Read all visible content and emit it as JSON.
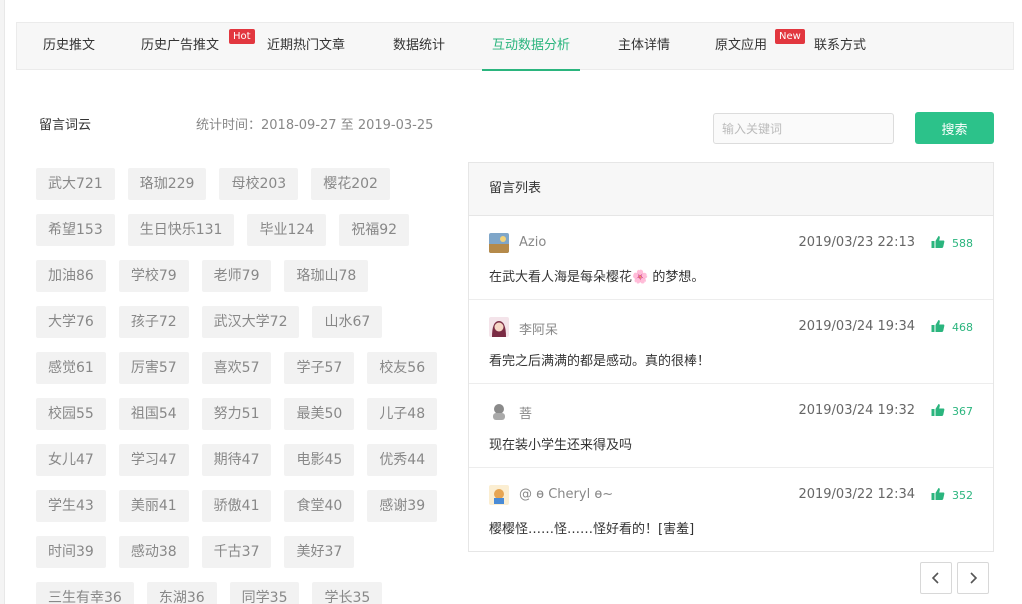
{
  "tabs": [
    {
      "label": "历史推文",
      "badge": ""
    },
    {
      "label": "历史广告推文",
      "badge": "Hot"
    },
    {
      "label": "近期热门文章",
      "badge": ""
    },
    {
      "label": "数据统计",
      "badge": ""
    },
    {
      "label": "互动数据分析",
      "badge": "",
      "active": true
    },
    {
      "label": "主体详情",
      "badge": ""
    },
    {
      "label": "原文应用",
      "badge": "New"
    },
    {
      "label": "联系方式",
      "badge": ""
    }
  ],
  "section": {
    "title": "留言词云",
    "stat_time": "统计时间：2018-09-27 至 2019-03-25"
  },
  "search": {
    "placeholder": "输入关键词",
    "value": "",
    "button_label": "搜索"
  },
  "word_cloud": [
    [
      "武大721",
      "珞珈229",
      "母校203",
      "樱花202"
    ],
    [
      "希望153",
      "生日快乐131",
      "毕业124",
      "祝福92"
    ],
    [
      "加油86",
      "学校79",
      "老师79",
      "珞珈山78"
    ],
    [
      "大学76",
      "孩子72",
      "武汉大学72",
      "山水67"
    ],
    [
      "感觉61",
      "厉害57",
      "喜欢57",
      "学子57",
      "校友56"
    ],
    [
      "校园55",
      "祖国54",
      "努力51",
      "最美50",
      "儿子48"
    ],
    [
      "女儿47",
      "学习47",
      "期待47",
      "电影45",
      "优秀44"
    ],
    [
      "学生43",
      "美丽41",
      "骄傲41",
      "食堂40",
      "感谢39"
    ],
    [
      "时间39",
      "感动38",
      "千古37",
      "美好37"
    ],
    [
      "三生有幸36",
      "东湖36",
      "同学35",
      "学长35"
    ]
  ],
  "comments": {
    "header": "留言列表",
    "items": [
      {
        "user": "Azio",
        "time": "2019/03/23 22:13",
        "likes": "588",
        "text": "在武大看人海是每朵樱花🌸 的梦想。",
        "avatar": "landscape"
      },
      {
        "user": "李阿呆",
        "time": "2019/03/24 19:34",
        "likes": "468",
        "text": "看完之后满满的都是感动。真的很棒！",
        "avatar": "girl"
      },
      {
        "user": "菩",
        "time": "2019/03/24 19:32",
        "likes": "367",
        "text": "现在装小学生还来得及吗",
        "avatar": "grey"
      },
      {
        "user": "@ ɵ Cheryl ɵ~",
        "time": "2019/03/22 12:34",
        "likes": "352",
        "text": "樱樱怪……怪……怪好看的！[害羞]",
        "avatar": "cartoon"
      }
    ]
  },
  "pagination": {
    "prev_icon": "chevron-left-icon",
    "next_icon": "chevron-right-icon"
  },
  "colors": {
    "accent": "#2bb57e",
    "button": "#2cc28a",
    "badge": "#e2373f"
  }
}
